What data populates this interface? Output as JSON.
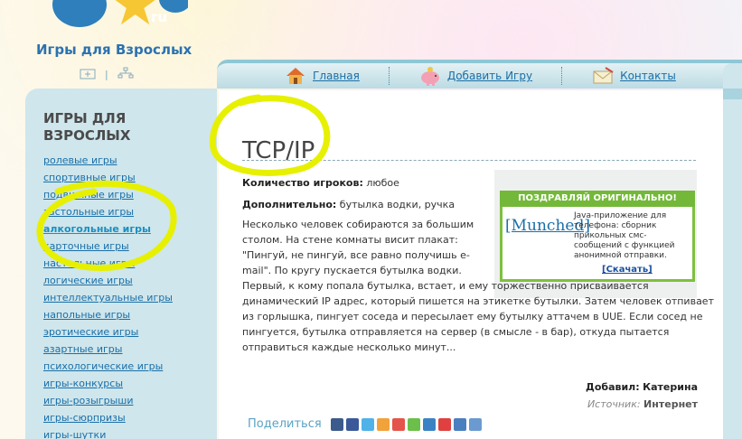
{
  "site": {
    "title": "Игры для Взрослых",
    "logo_text": "ru"
  },
  "sidebar": {
    "heading": "ИГРЫ ДЛЯ ВЗРОСЛЫХ",
    "items": [
      {
        "label": "ролевые игры"
      },
      {
        "label": "спортивные игры"
      },
      {
        "label": "подвижные игры"
      },
      {
        "label": "застольные игры"
      },
      {
        "label": "алкогольные игры",
        "active": true
      },
      {
        "label": "карточные игры"
      },
      {
        "label": "настольные игры"
      },
      {
        "label": "логические игры"
      },
      {
        "label": "интеллектуальные игры"
      },
      {
        "label": "напольные игры"
      },
      {
        "label": "эротические игры"
      },
      {
        "label": "азартные игры"
      },
      {
        "label": "психологические игры"
      },
      {
        "label": "игры-конкурсы"
      },
      {
        "label": "игры-розыгрыши"
      },
      {
        "label": "игры-сюрпризы"
      },
      {
        "label": "игры-шутки"
      }
    ]
  },
  "nav": {
    "home": "Главная",
    "add_game": "Добавить Игру",
    "contacts": "Контакты"
  },
  "article": {
    "title": "TCP/IP",
    "players_label": "Количество игроков:",
    "players_value": "любое",
    "extra_label": "Дополнительно:",
    "extra_value": "бутылка водки, ручка",
    "para1": "Несколько человек собираются за большим столом. На стене комнаты висит плакат: \"Пингуй, не пингуй, все равно получишь e-mail\". По кругу пускается бутылка водки.",
    "para2": "Первый, к кому попала бутылка, встает, и ему торжественно присваивается динамический IP адрес, который пишется на этикетке бутылки. Затем человек отпивает из горлышка, пингует соседа и пересылает ему бутылку аттачем в UUE. Если сосед не пингуется, бутылка отправляется на сервер (в смысле - в бар), откуда пытается отправиться каждые несколько минут...",
    "added_label": "Добавил:",
    "added_value": "Катерина",
    "source_label": "Источник:",
    "source_value": "Интернет",
    "share_label": "Поделиться"
  },
  "ad": {
    "header": "ПОЗДРАВЛЯЙ ОРИГИНАЛЬНО!",
    "link": "[Munched]",
    "text": "Java-приложение для телефона: сборник прикольных смс-сообщений с функцией анонимной отправки.",
    "download": "[Скачать]"
  },
  "colors": {
    "accent": "#1a6fa8",
    "sidebar_bg": "#cfe6ec",
    "highlight": "#e8f000",
    "ad_green": "#74b83a"
  }
}
